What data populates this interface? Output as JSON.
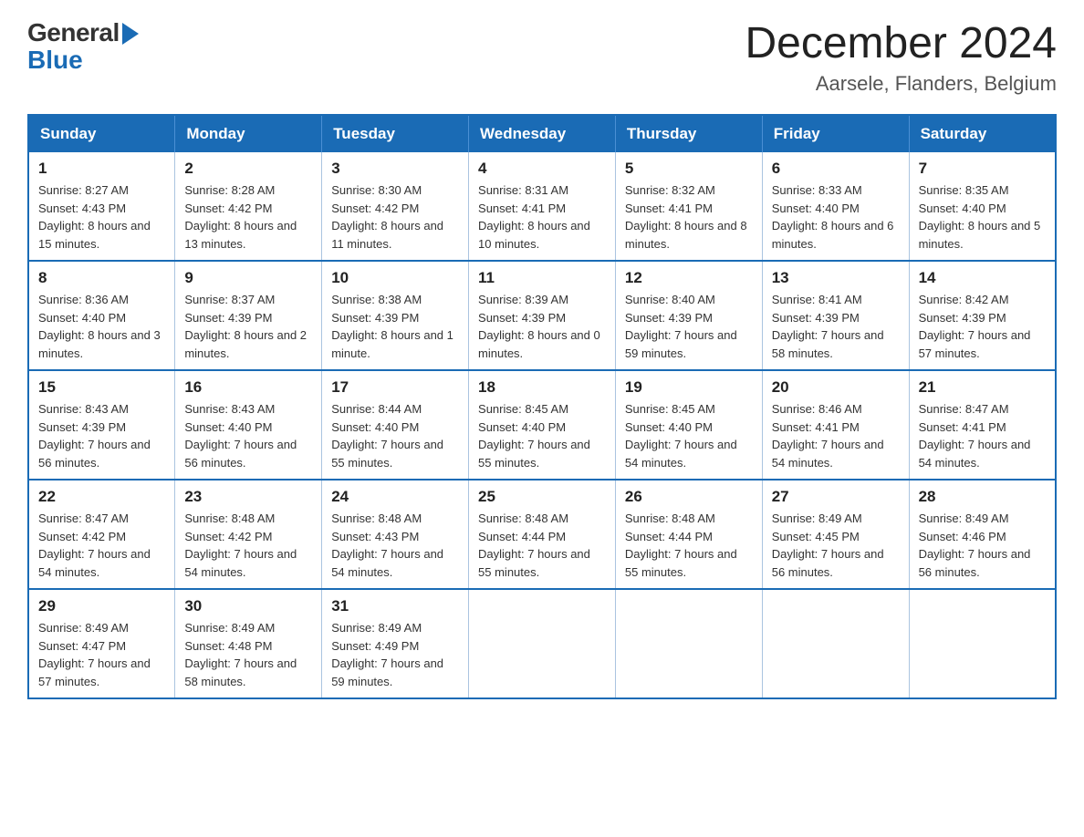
{
  "header": {
    "logo_general": "General",
    "logo_blue": "Blue",
    "title": "December 2024",
    "subtitle": "Aarsele, Flanders, Belgium"
  },
  "weekdays": [
    "Sunday",
    "Monday",
    "Tuesday",
    "Wednesday",
    "Thursday",
    "Friday",
    "Saturday"
  ],
  "weeks": [
    [
      {
        "day": "1",
        "sunrise": "8:27 AM",
        "sunset": "4:43 PM",
        "daylight": "8 hours and 15 minutes."
      },
      {
        "day": "2",
        "sunrise": "8:28 AM",
        "sunset": "4:42 PM",
        "daylight": "8 hours and 13 minutes."
      },
      {
        "day": "3",
        "sunrise": "8:30 AM",
        "sunset": "4:42 PM",
        "daylight": "8 hours and 11 minutes."
      },
      {
        "day": "4",
        "sunrise": "8:31 AM",
        "sunset": "4:41 PM",
        "daylight": "8 hours and 10 minutes."
      },
      {
        "day": "5",
        "sunrise": "8:32 AM",
        "sunset": "4:41 PM",
        "daylight": "8 hours and 8 minutes."
      },
      {
        "day": "6",
        "sunrise": "8:33 AM",
        "sunset": "4:40 PM",
        "daylight": "8 hours and 6 minutes."
      },
      {
        "day": "7",
        "sunrise": "8:35 AM",
        "sunset": "4:40 PM",
        "daylight": "8 hours and 5 minutes."
      }
    ],
    [
      {
        "day": "8",
        "sunrise": "8:36 AM",
        "sunset": "4:40 PM",
        "daylight": "8 hours and 3 minutes."
      },
      {
        "day": "9",
        "sunrise": "8:37 AM",
        "sunset": "4:39 PM",
        "daylight": "8 hours and 2 minutes."
      },
      {
        "day": "10",
        "sunrise": "8:38 AM",
        "sunset": "4:39 PM",
        "daylight": "8 hours and 1 minute."
      },
      {
        "day": "11",
        "sunrise": "8:39 AM",
        "sunset": "4:39 PM",
        "daylight": "8 hours and 0 minutes."
      },
      {
        "day": "12",
        "sunrise": "8:40 AM",
        "sunset": "4:39 PM",
        "daylight": "7 hours and 59 minutes."
      },
      {
        "day": "13",
        "sunrise": "8:41 AM",
        "sunset": "4:39 PM",
        "daylight": "7 hours and 58 minutes."
      },
      {
        "day": "14",
        "sunrise": "8:42 AM",
        "sunset": "4:39 PM",
        "daylight": "7 hours and 57 minutes."
      }
    ],
    [
      {
        "day": "15",
        "sunrise": "8:43 AM",
        "sunset": "4:39 PM",
        "daylight": "7 hours and 56 minutes."
      },
      {
        "day": "16",
        "sunrise": "8:43 AM",
        "sunset": "4:40 PM",
        "daylight": "7 hours and 56 minutes."
      },
      {
        "day": "17",
        "sunrise": "8:44 AM",
        "sunset": "4:40 PM",
        "daylight": "7 hours and 55 minutes."
      },
      {
        "day": "18",
        "sunrise": "8:45 AM",
        "sunset": "4:40 PM",
        "daylight": "7 hours and 55 minutes."
      },
      {
        "day": "19",
        "sunrise": "8:45 AM",
        "sunset": "4:40 PM",
        "daylight": "7 hours and 54 minutes."
      },
      {
        "day": "20",
        "sunrise": "8:46 AM",
        "sunset": "4:41 PM",
        "daylight": "7 hours and 54 minutes."
      },
      {
        "day": "21",
        "sunrise": "8:47 AM",
        "sunset": "4:41 PM",
        "daylight": "7 hours and 54 minutes."
      }
    ],
    [
      {
        "day": "22",
        "sunrise": "8:47 AM",
        "sunset": "4:42 PM",
        "daylight": "7 hours and 54 minutes."
      },
      {
        "day": "23",
        "sunrise": "8:48 AM",
        "sunset": "4:42 PM",
        "daylight": "7 hours and 54 minutes."
      },
      {
        "day": "24",
        "sunrise": "8:48 AM",
        "sunset": "4:43 PM",
        "daylight": "7 hours and 54 minutes."
      },
      {
        "day": "25",
        "sunrise": "8:48 AM",
        "sunset": "4:44 PM",
        "daylight": "7 hours and 55 minutes."
      },
      {
        "day": "26",
        "sunrise": "8:48 AM",
        "sunset": "4:44 PM",
        "daylight": "7 hours and 55 minutes."
      },
      {
        "day": "27",
        "sunrise": "8:49 AM",
        "sunset": "4:45 PM",
        "daylight": "7 hours and 56 minutes."
      },
      {
        "day": "28",
        "sunrise": "8:49 AM",
        "sunset": "4:46 PM",
        "daylight": "7 hours and 56 minutes."
      }
    ],
    [
      {
        "day": "29",
        "sunrise": "8:49 AM",
        "sunset": "4:47 PM",
        "daylight": "7 hours and 57 minutes."
      },
      {
        "day": "30",
        "sunrise": "8:49 AM",
        "sunset": "4:48 PM",
        "daylight": "7 hours and 58 minutes."
      },
      {
        "day": "31",
        "sunrise": "8:49 AM",
        "sunset": "4:49 PM",
        "daylight": "7 hours and 59 minutes."
      },
      null,
      null,
      null,
      null
    ]
  ]
}
